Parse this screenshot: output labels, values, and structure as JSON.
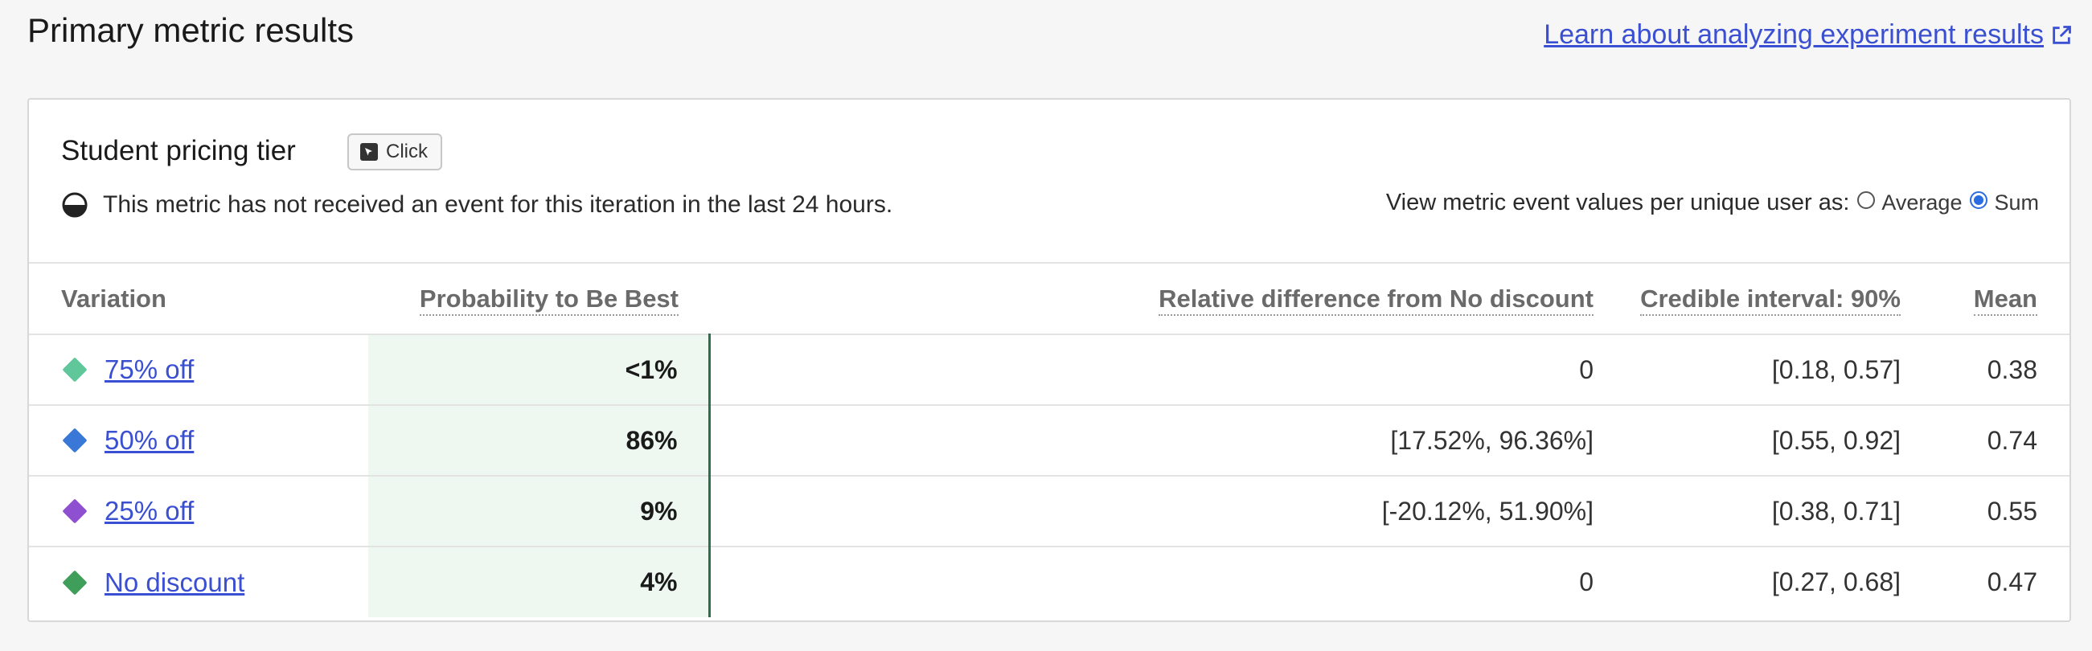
{
  "page": {
    "title": "Primary metric results",
    "learn_link": "Learn about analyzing experiment results"
  },
  "metric": {
    "name": "Student pricing tier",
    "badge": "Click",
    "status_text": "This metric has not received an event for this iteration in the last 24 hours.",
    "view_as_label": "View metric event values per unique user as:",
    "options": [
      {
        "label": "Average",
        "selected": false
      },
      {
        "label": "Sum",
        "selected": true
      }
    ]
  },
  "table": {
    "headers": {
      "variation": "Variation",
      "probability": "Probability to Be Best",
      "relative": "Relative difference from No discount",
      "credible": "Credible interval: 90%",
      "mean": "Mean"
    },
    "rows": [
      {
        "variation": "75% off",
        "color": "#5fc79a",
        "probability": "<1%",
        "relative": "0",
        "credible": "[0.18, 0.57]",
        "mean": "0.38"
      },
      {
        "variation": "50% off",
        "color": "#3a78d8",
        "probability": "86%",
        "relative": "[17.52%, 96.36%]",
        "credible": "[0.55, 0.92]",
        "mean": "0.74"
      },
      {
        "variation": "25% off",
        "color": "#8e4fd0",
        "probability": "9%",
        "relative": "[-20.12%, 51.90%]",
        "credible": "[0.38, 0.71]",
        "mean": "0.55"
      },
      {
        "variation": "No discount",
        "color": "#3f9e5a",
        "probability": "4%",
        "relative": "0",
        "credible": "[0.27, 0.68]",
        "mean": "0.47"
      }
    ]
  },
  "icons": {
    "external_link": "external-link-icon",
    "cursor": "cursor-click-icon",
    "status": "half-circle-icon"
  }
}
